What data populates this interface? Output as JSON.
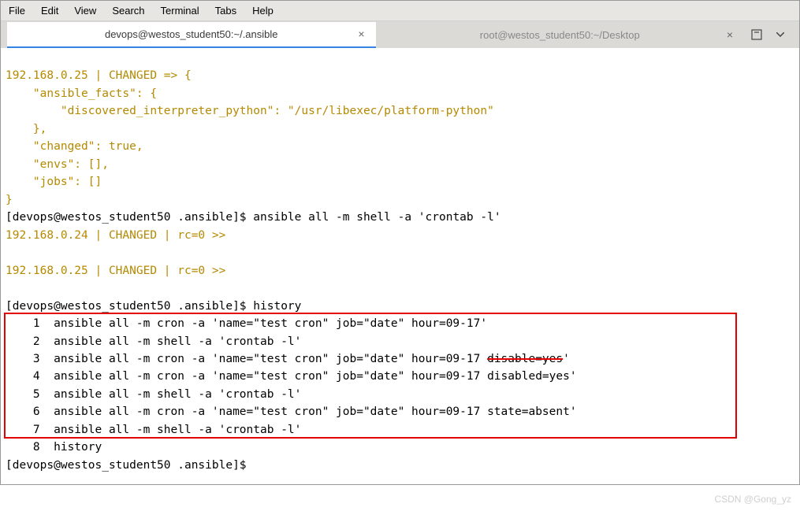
{
  "menu": {
    "file": "File",
    "edit": "Edit",
    "view": "View",
    "search": "Search",
    "terminal": "Terminal",
    "tabs": "Tabs",
    "help": "Help"
  },
  "tabs": {
    "t1": "devops@westos_student50:~/.ansible",
    "t2": "root@westos_student50:~/Desktop"
  },
  "term": {
    "l1": "192.168.0.25 | CHANGED => {",
    "l2": "    \"ansible_facts\": {",
    "l3": "        \"discovered_interpreter_python\": \"/usr/libexec/platform-python\"",
    "l4": "    },",
    "l5": "    \"changed\": true,",
    "l6": "    \"envs\": [],",
    "l7": "    \"jobs\": []",
    "l8": "}",
    "p1_prompt": "[devops@westos_student50 .ansible]$ ",
    "p1_cmd": "ansible all -m shell -a 'crontab -l'",
    "l10": "192.168.0.24 | CHANGED | rc=0 >>",
    "l11": "",
    "l12": "192.168.0.25 | CHANGED | rc=0 >>",
    "l13": "",
    "p2_prompt": "[devops@westos_student50 .ansible]$ ",
    "p2_cmd": "history",
    "h1": "    1  ansible all -m cron -a 'name=\"test cron\" job=\"date\" hour=09-17'",
    "h2": "    2  ansible all -m shell -a 'crontab -l'",
    "h3a": "    3  ansible all -m cron -a 'name=\"test cron\" job=\"date\" hour=09-17 ",
    "h3b": "disable=yes",
    "h3c": "'",
    "h4": "    4  ansible all -m cron -a 'name=\"test cron\" job=\"date\" hour=09-17 disabled=yes'",
    "h5": "    5  ansible all -m shell -a 'crontab -l'",
    "h6": "    6  ansible all -m cron -a 'name=\"test cron\" job=\"date\" hour=09-17 state=absent'",
    "h7": "    7  ansible all -m shell -a 'crontab -l'",
    "h8": "    8  history",
    "p3_prompt": "[devops@westos_student50 .ansible]$ "
  },
  "watermark": "CSDN @Gong_yz"
}
